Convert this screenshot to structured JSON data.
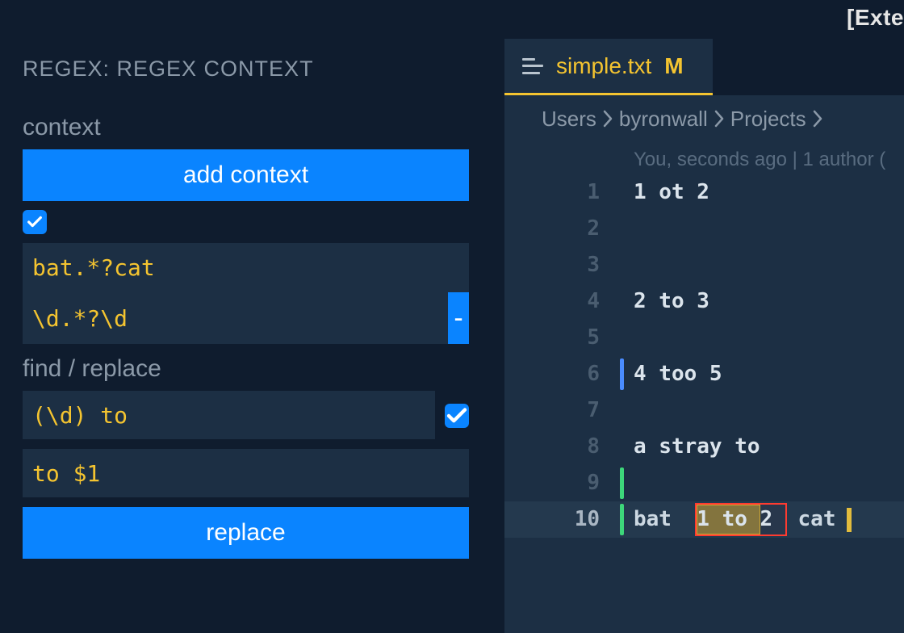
{
  "topright": "[Exte",
  "sidebar": {
    "panel_title": "REGEX: REGEX CONTEXT",
    "context": {
      "label": "context",
      "add_button": "add context",
      "enabled": true,
      "patterns": [
        "bat.*?cat",
        "\\d.*?\\d"
      ]
    },
    "find_replace": {
      "label": "find / replace",
      "find_value": "(\\d) to",
      "find_enabled": true,
      "replace_value": "to $1",
      "replace_button": "replace"
    }
  },
  "editor": {
    "active_tab": {
      "filename": "simple.txt",
      "status_badge": "M"
    },
    "breadcrumbs": [
      "Users",
      "byronwall",
      "Projects"
    ],
    "meta": "You, seconds ago | 1 author (",
    "lines": [
      {
        "n": 1,
        "text": "1 ot 2"
      },
      {
        "n": 2,
        "text": ""
      },
      {
        "n": 3,
        "text": ""
      },
      {
        "n": 4,
        "text": "2 to 3"
      },
      {
        "n": 5,
        "text": ""
      },
      {
        "n": 6,
        "text": "4 too 5",
        "marker": "blue"
      },
      {
        "n": 7,
        "text": ""
      },
      {
        "n": 8,
        "text": "a stray to"
      },
      {
        "n": 9,
        "text": "",
        "marker": "green"
      },
      {
        "n": 10,
        "text": "bat  1 to 2  cat",
        "marker": "green",
        "active": true,
        "highlight": {
          "outer_start": 5,
          "outer_end": 11,
          "inner_start": 5,
          "inner_end": 9
        },
        "cursor_after": true
      }
    ]
  },
  "colors": {
    "accent_blue": "#0a84ff",
    "accent_yellow": "#f4c430",
    "bg_dark": "#0f1c2e",
    "bg_panel": "#1c2f44",
    "text_muted": "#8b99a8"
  }
}
